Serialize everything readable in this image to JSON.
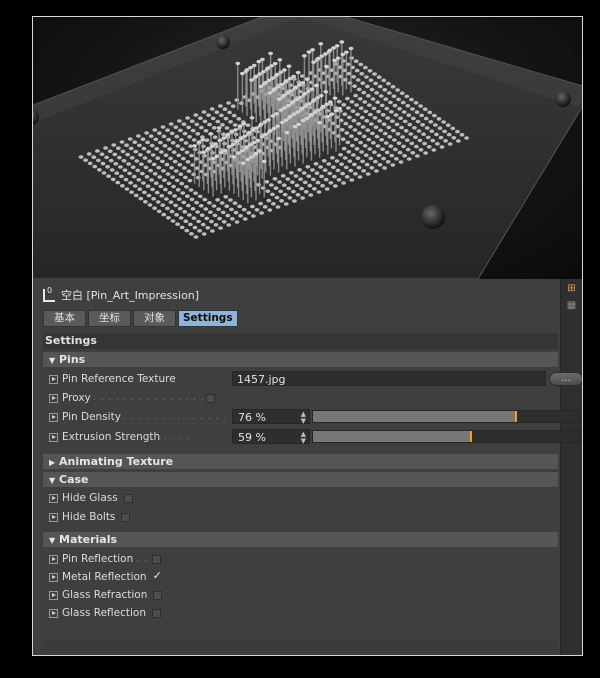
{
  "object": {
    "title": "空白 [Pin_Art_Impression]"
  },
  "tabs": [
    {
      "label": "基本",
      "active": false
    },
    {
      "label": "坐标",
      "active": false
    },
    {
      "label": "对象",
      "active": false
    },
    {
      "label": "Settings",
      "active": true
    }
  ],
  "section_title": "Settings",
  "groups": {
    "pins": {
      "title": "Pins",
      "reference_texture": {
        "label": "Pin Reference Texture",
        "value": "1457.jpg",
        "browse_label": "..."
      },
      "proxy": {
        "label": "Proxy",
        "checked": false
      },
      "pin_density": {
        "label": "Pin Density",
        "value": "76 %",
        "fraction": 0.76
      },
      "extrusion_strength": {
        "label": "Extrusion Strength",
        "value": "59 %",
        "fraction": 0.59
      }
    },
    "animating_texture": {
      "title": "Animating Texture",
      "expanded": false
    },
    "case": {
      "title": "Case",
      "hide_glass": {
        "label": "Hide Glass",
        "checked": false
      },
      "hide_bolts": {
        "label": "Hide Bolts",
        "checked": false
      }
    },
    "materials": {
      "title": "Materials",
      "pin_reflection": {
        "label": "Pin Reflection",
        "checked": false
      },
      "metal_reflection": {
        "label": "Metal Reflection",
        "checked": true,
        "mark": "✓"
      },
      "glass_refraction": {
        "label": "Glass Refraction",
        "checked": false
      },
      "glass_reflection": {
        "label": "Glass Reflection",
        "checked": false
      }
    }
  },
  "colors": {
    "accent_tab": "#8fb3d9",
    "slider_handle": "#f0a020",
    "panel_bg": "#3f3f3f"
  },
  "icons": {
    "object": "null-object-icon",
    "lock": "lock-icon",
    "expand": "triangle-down-icon",
    "collapse": "triangle-right-icon"
  }
}
